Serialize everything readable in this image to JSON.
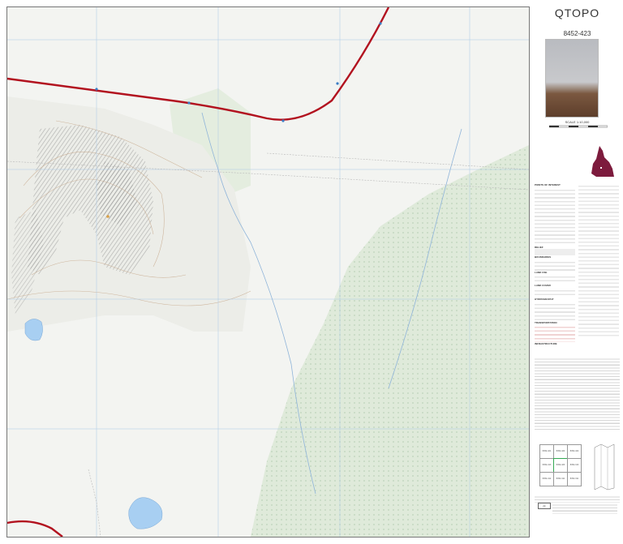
{
  "header": {
    "title": "QTOPO",
    "sheet_number": "8452-423",
    "scale": "SCALE 1:10,000"
  },
  "legend": {
    "headings": [
      "POINTS OF INTEREST",
      "RELIEF",
      "BOUNDARIES",
      "LAND USE",
      "LAND COVER",
      "HYDROGRAPHY",
      "TRANSPORTATION",
      "INFRASTRUCTURE"
    ]
  },
  "map_index": {
    "cells": [
      "8452-421",
      "8452-424",
      "8452-422",
      "8452-413",
      "8452-423",
      "8452-313",
      "8452-412",
      "8452-411",
      "8452-311"
    ]
  },
  "colors": {
    "road": "#b2121f",
    "water": "#a8cff2",
    "vegetation": "#d8e6d2",
    "terrain": "#f3f4f1",
    "queensland": "#7d1b3d"
  },
  "icons": [
    "queensland-locator-icon",
    "creative-commons-icon",
    "photo-thumbnail"
  ]
}
